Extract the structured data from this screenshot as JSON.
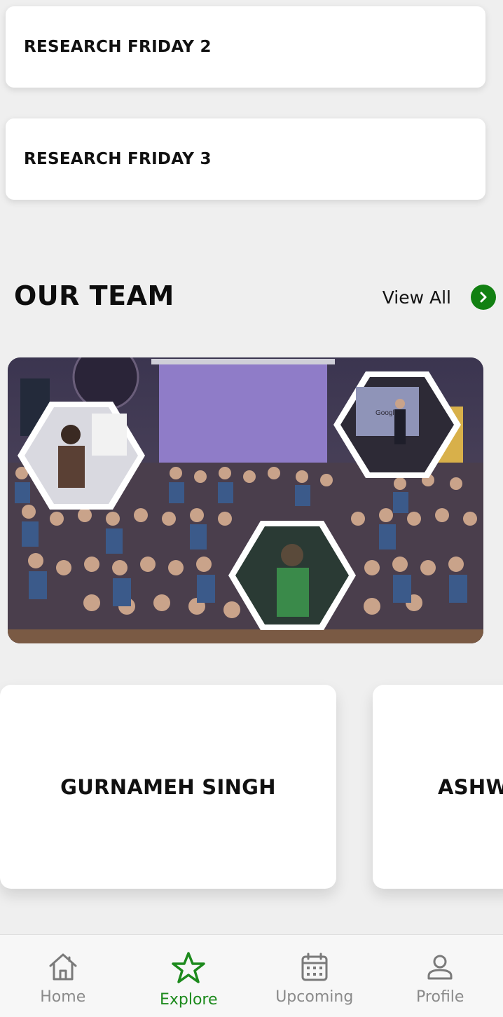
{
  "events": [
    {
      "label": "RESEARCH FRIDAY 2"
    },
    {
      "label": "RESEARCH FRIDAY 3"
    }
  ],
  "team": {
    "title": "OUR TEAM",
    "view_all": "View All",
    "members": [
      {
        "name": "GURNAMEH SINGH"
      },
      {
        "name": "ASHW"
      }
    ]
  },
  "nav": {
    "items": [
      {
        "label": "Home",
        "icon": "home-icon"
      },
      {
        "label": "Explore",
        "icon": "star-icon",
        "active": true
      },
      {
        "label": "Upcoming",
        "icon": "calendar-icon"
      },
      {
        "label": "Profile",
        "icon": "person-icon"
      }
    ]
  },
  "colors": {
    "accent": "#1d8a1d",
    "inactive": "#8a8a8a"
  },
  "hero_image": {
    "screen_text": "Google"
  }
}
